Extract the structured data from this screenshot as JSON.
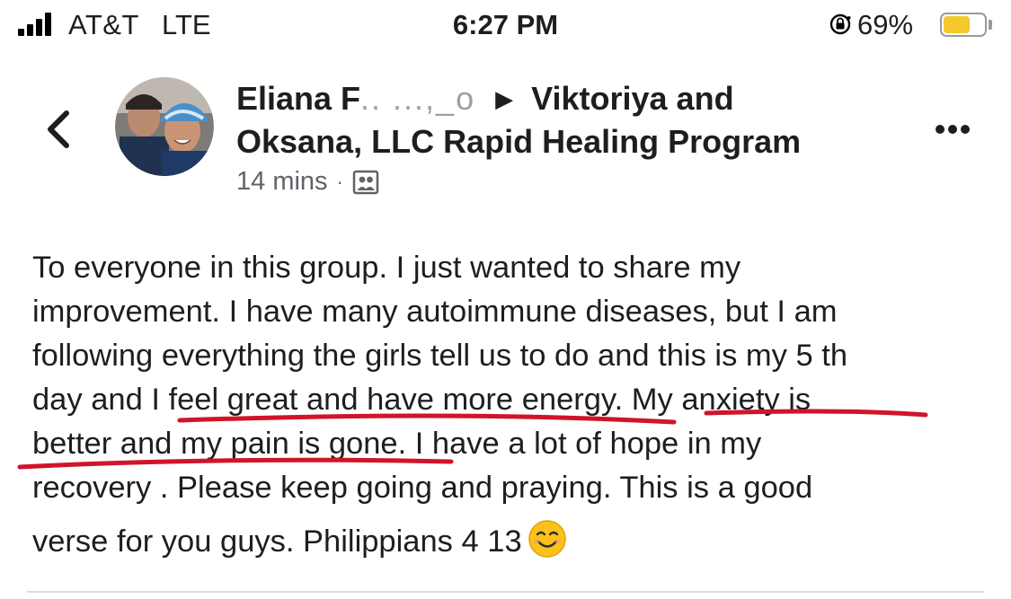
{
  "status_bar": {
    "carrier": "AT&T",
    "network": "LTE",
    "time": "6:27 PM",
    "battery_percent": "69%",
    "battery_level": 0.69,
    "battery_color": "#f3c92c",
    "icons": [
      "signal-icon",
      "orientation-lock-icon",
      "battery-icon"
    ]
  },
  "post": {
    "author_line_1": "Eliana F",
    "author_line_obscured": "Eliana F... ...o",
    "target_group_line_1": "Viktoriya and",
    "target_group_line_2": "Oksana, LLC Rapid Healing Program",
    "timestamp": "14 mins",
    "separator": "·",
    "audience_icon": "group-members-icon",
    "body_lines": [
      "To everyone in this group. I just wanted to share my",
      "improvement. I have many autoimmune diseases, but I am",
      "following everything the girls tell us to do and this is my 5 th",
      "day and I feel great and have more energy. My anxiety is",
      "better and my pain is gone. I have a lot of hope in my",
      "recovery . Please keep going and praying.  This is a good",
      "verse for you guys. Philippians 4 13"
    ],
    "emoji": "smiling-face-emoji",
    "annotation_color": "#d0142a"
  },
  "nav": {
    "back_icon": "chevron-left-icon",
    "more_icon": "more-options-icon"
  }
}
